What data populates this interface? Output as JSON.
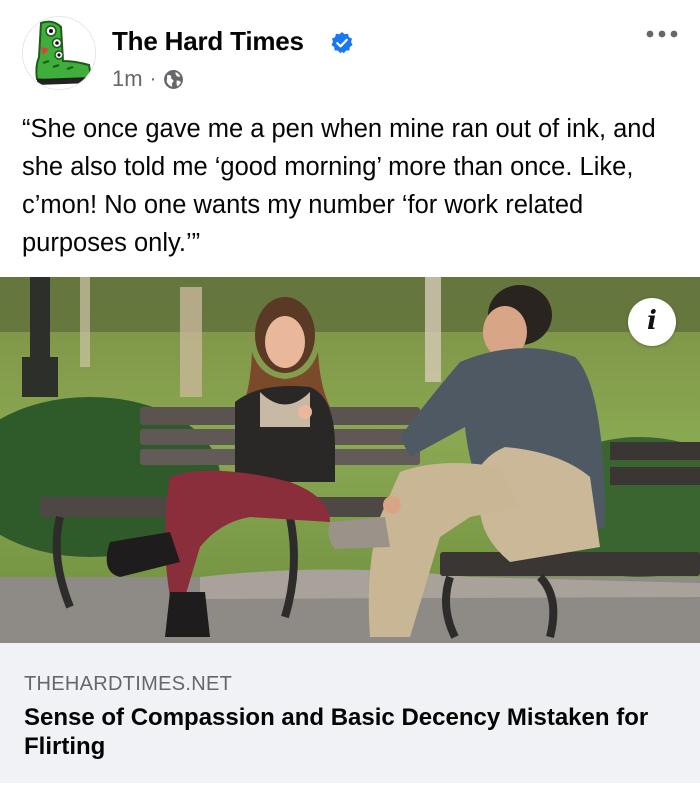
{
  "post": {
    "page_name": "The Hard Times",
    "time": "1m",
    "separator": "·",
    "verified": true,
    "audience_icon": "globe-icon",
    "more_icon": "more-options-icon",
    "caption": "“She once gave me a pen when mine ran out of ink, and she also told me ‘good morning’ more than once. Like, c’mon! No one wants my number ‘for work related purposes only.’”"
  },
  "link_preview": {
    "image_description_icon": "info-icon",
    "info_glyph": "i",
    "domain": "THEHARDTIMES.NET",
    "title": "Sense of Compassion and Basic Decency Mistaken for Flirting"
  },
  "colors": {
    "text_primary": "#050505",
    "text_secondary": "#65676b",
    "verified_blue": "#1877f2",
    "card_bg": "#f0f2f5",
    "avatar_green": "#3fae3a"
  }
}
